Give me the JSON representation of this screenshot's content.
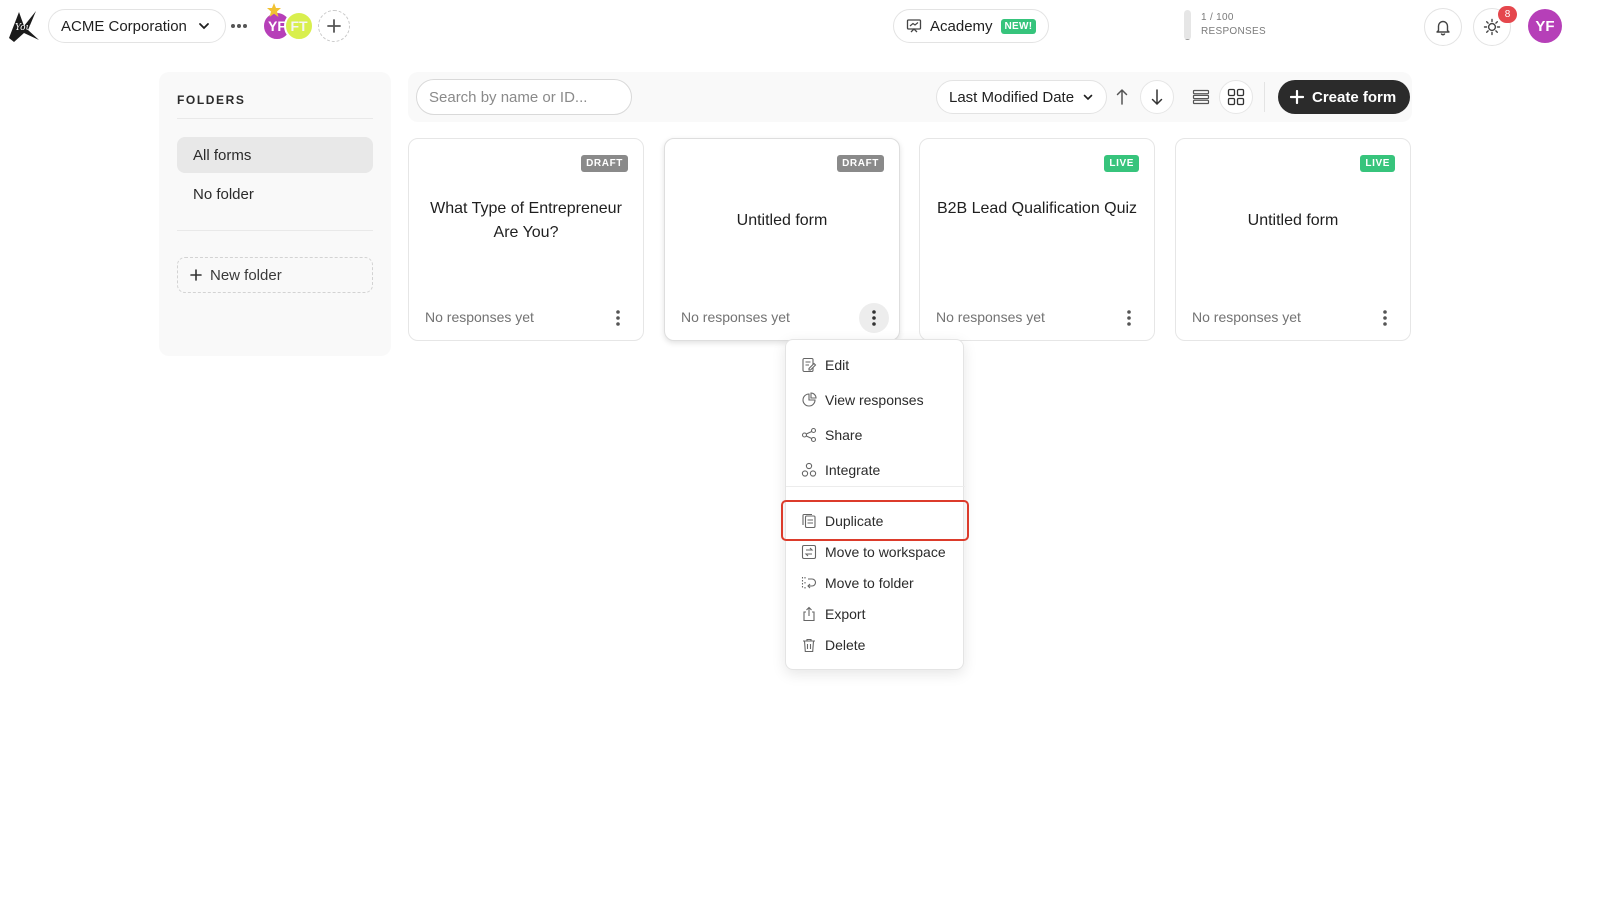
{
  "topbar": {
    "workspace": "ACME Corporation",
    "members": [
      {
        "initials": "YF",
        "color": "#b63fb8"
      },
      {
        "initials": "FT",
        "color": "#d9ef4e"
      }
    ],
    "academy_label": "Academy",
    "academy_badge": "NEW!",
    "usage": {
      "count": "1 / 100",
      "unit": "RESPONSES",
      "used": 1,
      "limit": 100
    },
    "notification_count": "8",
    "user_initials": "YF"
  },
  "sidebar": {
    "title": "FOLDERS",
    "items": [
      {
        "label": "All forms",
        "selected": true
      },
      {
        "label": "No folder",
        "selected": false
      }
    ],
    "new_folder": "New folder"
  },
  "toolbar": {
    "search_placeholder": "Search by name or ID...",
    "sort_label": "Last Modified Date",
    "create_label": "Create form"
  },
  "forms": [
    {
      "title": "What Type of Entrepreneur Are You?",
      "status": "DRAFT",
      "responses": "No responses yet"
    },
    {
      "title": "Untitled form",
      "status": "DRAFT",
      "responses": "No responses yet"
    },
    {
      "title": "B2B Lead Qualification Quiz",
      "status": "LIVE",
      "responses": "No responses yet"
    },
    {
      "title": "Untitled form",
      "status": "LIVE",
      "responses": "No responses yet"
    }
  ],
  "context_menu": {
    "items": [
      {
        "label": "Edit",
        "icon": "edit-icon"
      },
      {
        "label": "View responses",
        "icon": "chart-icon"
      },
      {
        "label": "Share",
        "icon": "share-icon"
      },
      {
        "label": "Integrate",
        "icon": "integrate-icon"
      },
      {
        "label": "Duplicate",
        "icon": "duplicate-icon",
        "highlighted": true
      },
      {
        "label": "Move to workspace",
        "icon": "move-workspace-icon"
      },
      {
        "label": "Move to folder",
        "icon": "move-folder-icon"
      },
      {
        "label": "Export",
        "icon": "export-icon"
      },
      {
        "label": "Delete",
        "icon": "trash-icon"
      }
    ]
  },
  "colors": {
    "accent_dark": "#2b2b2b",
    "draft": "#8a8a8a",
    "live": "#37c47c",
    "avatar": "#b63fb8",
    "highlight": "#dc3b2b",
    "badge": "#e5474d"
  }
}
